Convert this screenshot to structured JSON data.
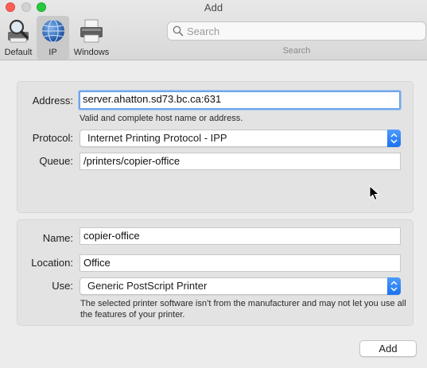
{
  "window": {
    "title": "Add"
  },
  "toolbar": {
    "items": [
      {
        "label": "Default",
        "icon": "magnifier-printer-icon"
      },
      {
        "label": "IP",
        "icon": "globe-icon",
        "selected": true
      },
      {
        "label": "Windows",
        "icon": "printer-icon"
      }
    ],
    "search": {
      "placeholder": "Search",
      "value": "",
      "caption": "Search"
    }
  },
  "connection": {
    "address_label": "Address:",
    "address_value": "server.ahatton.sd73.bc.ca:631",
    "address_hint": "Valid and complete host name or address.",
    "protocol_label": "Protocol:",
    "protocol_value": "Internet Printing Protocol - IPP",
    "queue_label": "Queue:",
    "queue_value": "/printers/copier-office"
  },
  "printer": {
    "name_label": "Name:",
    "name_value": "copier-office",
    "location_label": "Location:",
    "location_value": "Office",
    "use_label": "Use:",
    "use_value": "Generic PostScript Printer",
    "use_note": "The selected printer software isn’t from the manufacturer and may not let you use all the features of your printer."
  },
  "actions": {
    "add_label": "Add"
  },
  "colors": {
    "accent": "#1a72f0",
    "focus_ring": "#6ea5e8",
    "close": "#fe5f57",
    "zoom": "#28c840"
  }
}
